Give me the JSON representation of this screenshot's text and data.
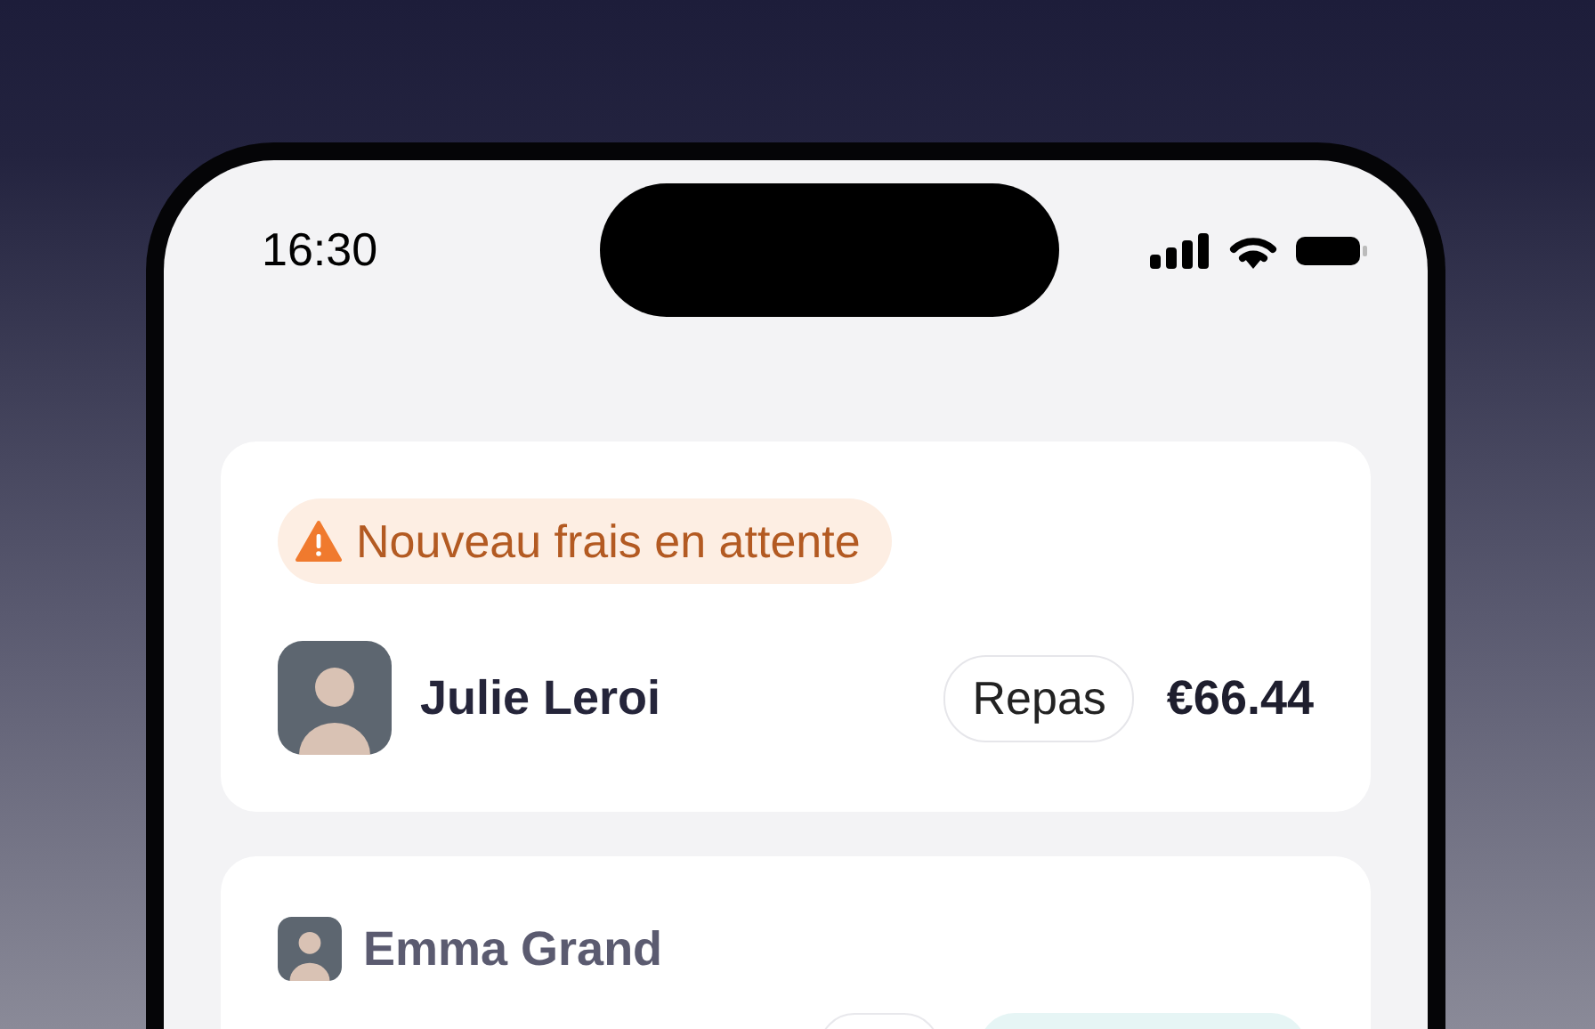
{
  "status_bar": {
    "time": "16:30"
  },
  "cards": [
    {
      "alert": {
        "kind": "warning",
        "text": "Nouveau frais en attente"
      },
      "person": "Julie Leroi",
      "category": "Repas",
      "amount": "€66.44"
    },
    {
      "person": "Emma Grand",
      "chips": [
        {
          "kind": "outline"
        },
        {
          "kind": "teal"
        }
      ]
    }
  ]
}
